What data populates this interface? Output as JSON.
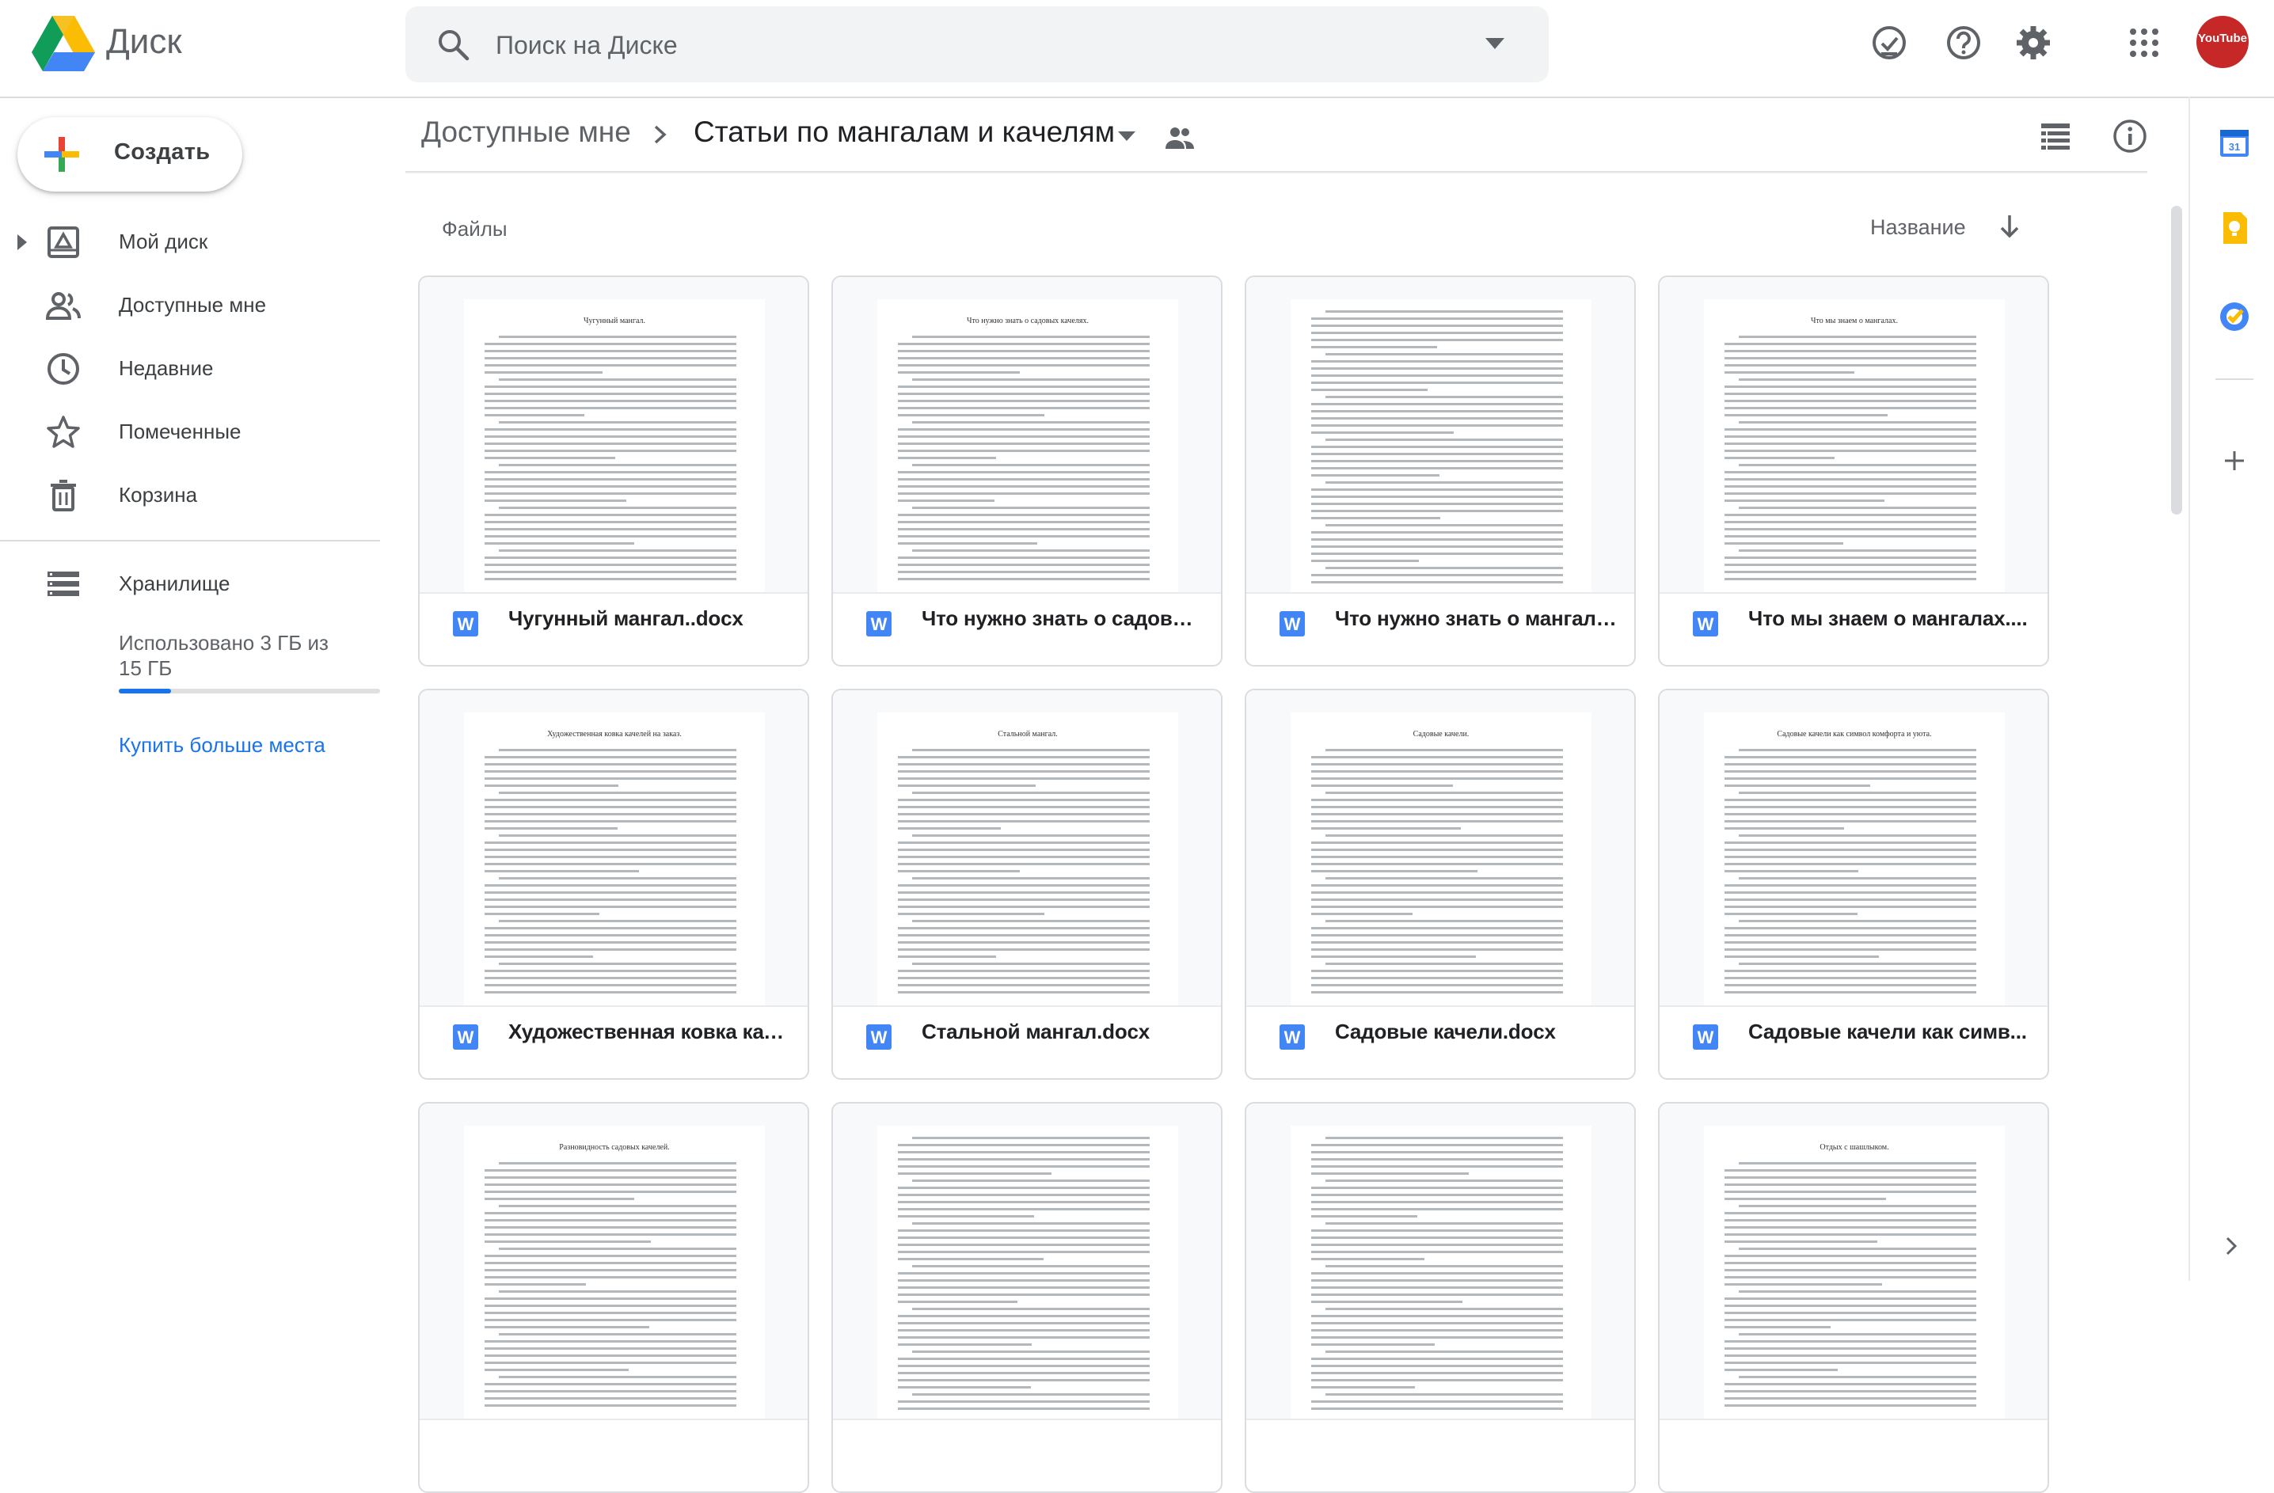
{
  "header": {
    "app_title": "Диск",
    "search_placeholder": "Поиск на Диске",
    "avatar_text": "YouTube"
  },
  "sidebar": {
    "create_label": "Создать",
    "items": [
      {
        "label": "Мой диск",
        "icon": "my-drive-icon"
      },
      {
        "label": "Доступные мне",
        "icon": "shared-with-me-icon"
      },
      {
        "label": "Недавние",
        "icon": "recent-icon"
      },
      {
        "label": "Помеченные",
        "icon": "star-icon"
      },
      {
        "label": "Корзина",
        "icon": "trash-icon"
      }
    ],
    "storage_label": "Хранилище",
    "storage_used_text": "Использовано 3 ГБ из 15 ГБ",
    "storage_used_fraction": 0.2,
    "buy_storage_link": "Купить больше места"
  },
  "breadcrumb": {
    "parent": "Доступные мне",
    "current": "Статьи по мангалам и качелям"
  },
  "files_section": {
    "label": "Файлы",
    "sort_label": "Название"
  },
  "files": [
    {
      "name": "Чугунный мангал..docx",
      "preview_title": "Чугунный мангал."
    },
    {
      "name": "Что нужно знать о садовы...",
      "preview_title": "Что нужно знать о садовых качелях."
    },
    {
      "name": "Что нужно знать о мангала...",
      "preview_title": ""
    },
    {
      "name": "Что мы знаем о мангалах....",
      "preview_title": "Что мы знаем о мангалах."
    },
    {
      "name": "Художественная ковка кач...",
      "preview_title": "Художественная ковка качелей на заказ."
    },
    {
      "name": "Стальной мангал.docx",
      "preview_title": "Стальной мангал."
    },
    {
      "name": "Садовые качели.docx",
      "preview_title": "Садовые качели."
    },
    {
      "name": "Садовые качели как симв...",
      "preview_title": "Садовые качели как символ комфорта и уюта."
    },
    {
      "name": "",
      "preview_title": "Разновидность садовых качелей."
    },
    {
      "name": "",
      "preview_title": ""
    },
    {
      "name": "",
      "preview_title": ""
    },
    {
      "name": "",
      "preview_title": "Отдых с шашлыком."
    }
  ],
  "colors": {
    "accent": "#1a73e8",
    "doc_icon": "#4285f4",
    "text_secondary": "#5f6368"
  }
}
